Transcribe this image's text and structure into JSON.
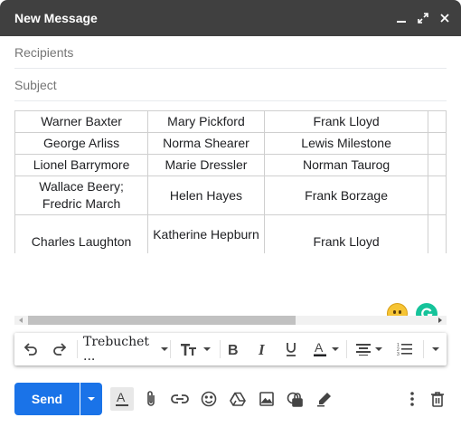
{
  "window": {
    "title": "New Message"
  },
  "fields": {
    "recipients_placeholder": "Recipients",
    "subject_placeholder": "Subject"
  },
  "table": {
    "rows": [
      [
        "Warner Baxter",
        "Mary Pickford",
        "Frank Lloyd",
        ""
      ],
      [
        "George Arliss",
        "Norma Shearer",
        "Lewis Milestone",
        ""
      ],
      [
        "Lionel Barrymore",
        "Marie Dressler",
        "Norman Taurog",
        ""
      ],
      [
        "Wallace Beery; Fredric March",
        "Helen Hayes",
        "Frank Borzage",
        ""
      ],
      [
        "Charles Laughton",
        "Katherine Hepburn",
        "Frank Lloyd",
        ""
      ]
    ]
  },
  "scrollbar": {
    "horizontal_position": 0.0,
    "visible_fraction": 0.62
  },
  "toolbar": {
    "font_name": "Trebuchet ..."
  },
  "footer": {
    "send_label": "Send"
  },
  "colors": {
    "titlebar": "#404040",
    "send": "#1a73e8",
    "grammarly": "#15c39a"
  }
}
